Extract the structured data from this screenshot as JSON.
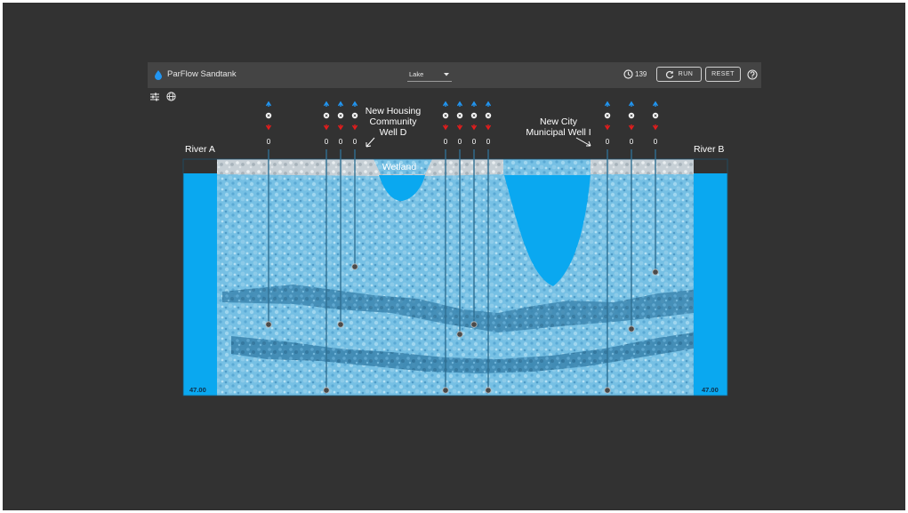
{
  "app": {
    "title": "ParFlow Sandtank",
    "mode_select": "Lake",
    "time_value": "139",
    "run_label": "RUN",
    "reset_label": "RESET"
  },
  "icons": {
    "logo": "water-drop-icon",
    "time": "clock-icon",
    "run": "refresh-icon",
    "help": "help-circle-icon",
    "settings": "sliders-icon",
    "view": "globe-icon"
  },
  "colors": {
    "background": "#323232",
    "toolbar": "#444444",
    "water": "#0aa8f0",
    "pump_up": "#2196f3",
    "pump_down": "#e51c1c"
  },
  "rivers": {
    "left_label": "River A",
    "right_label": "River B",
    "left_level": "47.00",
    "right_level": "47.00"
  },
  "annotations": {
    "housing_line1": "New Housing",
    "housing_line2": "Community",
    "housing_line3": "Well D",
    "city_line1": "New City",
    "city_line2": "Municipal Well I",
    "wetland": "Wetland"
  },
  "wells": [
    {
      "id": "A",
      "pump_rate": "0"
    },
    {
      "id": "B",
      "pump_rate": "0"
    },
    {
      "id": "C",
      "pump_rate": "0"
    },
    {
      "id": "D",
      "pump_rate": "0"
    },
    {
      "id": "E",
      "pump_rate": "0"
    },
    {
      "id": "F",
      "pump_rate": "0"
    },
    {
      "id": "G",
      "pump_rate": "0"
    },
    {
      "id": "H",
      "pump_rate": "0"
    },
    {
      "id": "I",
      "pump_rate": "0"
    },
    {
      "id": "J",
      "pump_rate": "0"
    },
    {
      "id": "K",
      "pump_rate": "0"
    }
  ]
}
